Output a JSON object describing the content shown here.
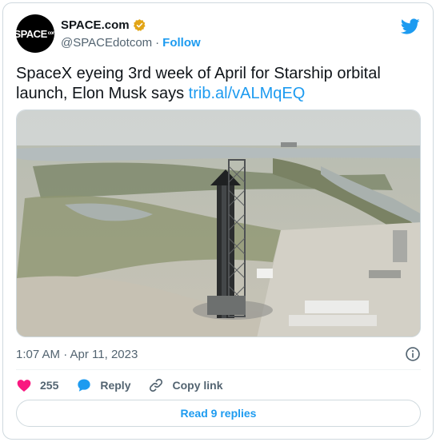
{
  "author": {
    "avatar_text": "SPACE",
    "avatar_suffix": "com",
    "name": "SPACE.com",
    "handle": "@SPACEdotcom",
    "separator": "·",
    "follow_label": "Follow"
  },
  "tweet": {
    "text": "SpaceX eyeing 3rd week of April for Starship orbital launch, Elon Musk says ",
    "link_text": "trib.al/vALMqEQ"
  },
  "media": {
    "icon": "starship-launch-photo"
  },
  "meta": {
    "timestamp": "1:07 AM · Apr 11, 2023"
  },
  "actions": {
    "likes": "255",
    "reply_label": "Reply",
    "copy_link_label": "Copy link"
  },
  "footer": {
    "read_replies_label": "Read 9 replies"
  },
  "colors": {
    "accent": "#1d9bf0",
    "like": "#f91880",
    "verified": "#e2a517",
    "text": "#0f1419",
    "muted": "#536471"
  }
}
